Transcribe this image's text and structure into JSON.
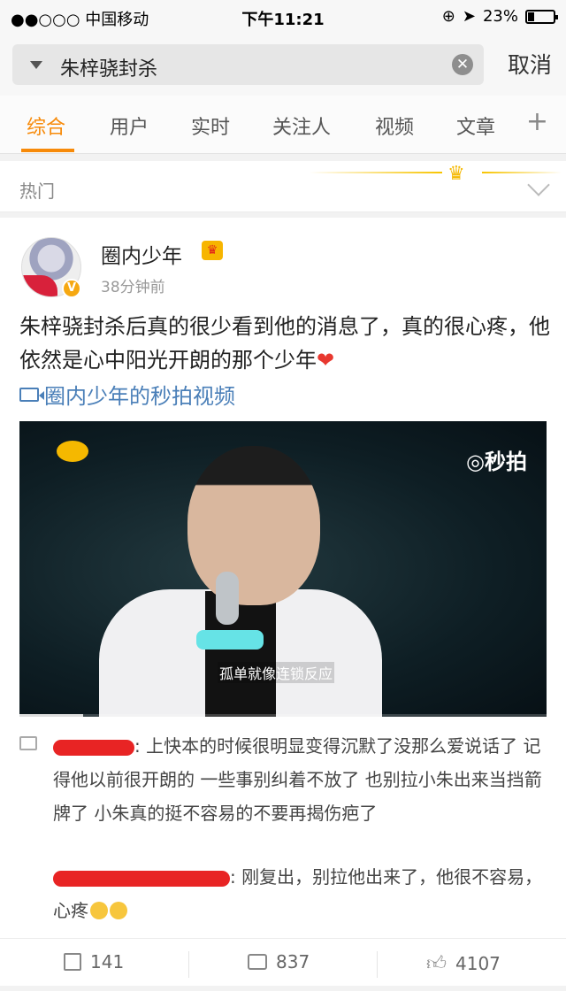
{
  "status": {
    "carrier": "●●○○○ 中国移动",
    "wifi": "wifi-icon",
    "time": "下午11:21",
    "battery": "23%",
    "battery_level": 0.23
  },
  "search": {
    "query": "朱梓骁封杀",
    "cancel": "取消"
  },
  "tabs": [
    "综合",
    "用户",
    "实时",
    "关注人",
    "视频",
    "文章"
  ],
  "hot": {
    "label": "热门"
  },
  "post": {
    "user": "圈内少年",
    "time": "38分钟前",
    "text": "朱梓骁封杀后真的很少看到他的消息了，真的很心疼，他依然是心中阳光开朗的那个少年",
    "video_link": "圈内少年的秒拍视频",
    "video": {
      "watermark": "秒拍",
      "subtitle": "孤单就像连锁反应",
      "progress": 0.12
    },
    "comments": [
      {
        "text": ": 上快本的时候很明显变得沉默了没那么爱说话了 记得他以前很开朗的 一些事别纠着不放了 也别拉小朱出来当挡箭牌了 小朱真的挺不容易的不要再揭伤疤了"
      },
      {
        "text": ": 刚复出，别拉他出来了，他很不容易，心疼"
      }
    ],
    "reposts": "141",
    "comment_count": "837",
    "likes": "4107"
  }
}
